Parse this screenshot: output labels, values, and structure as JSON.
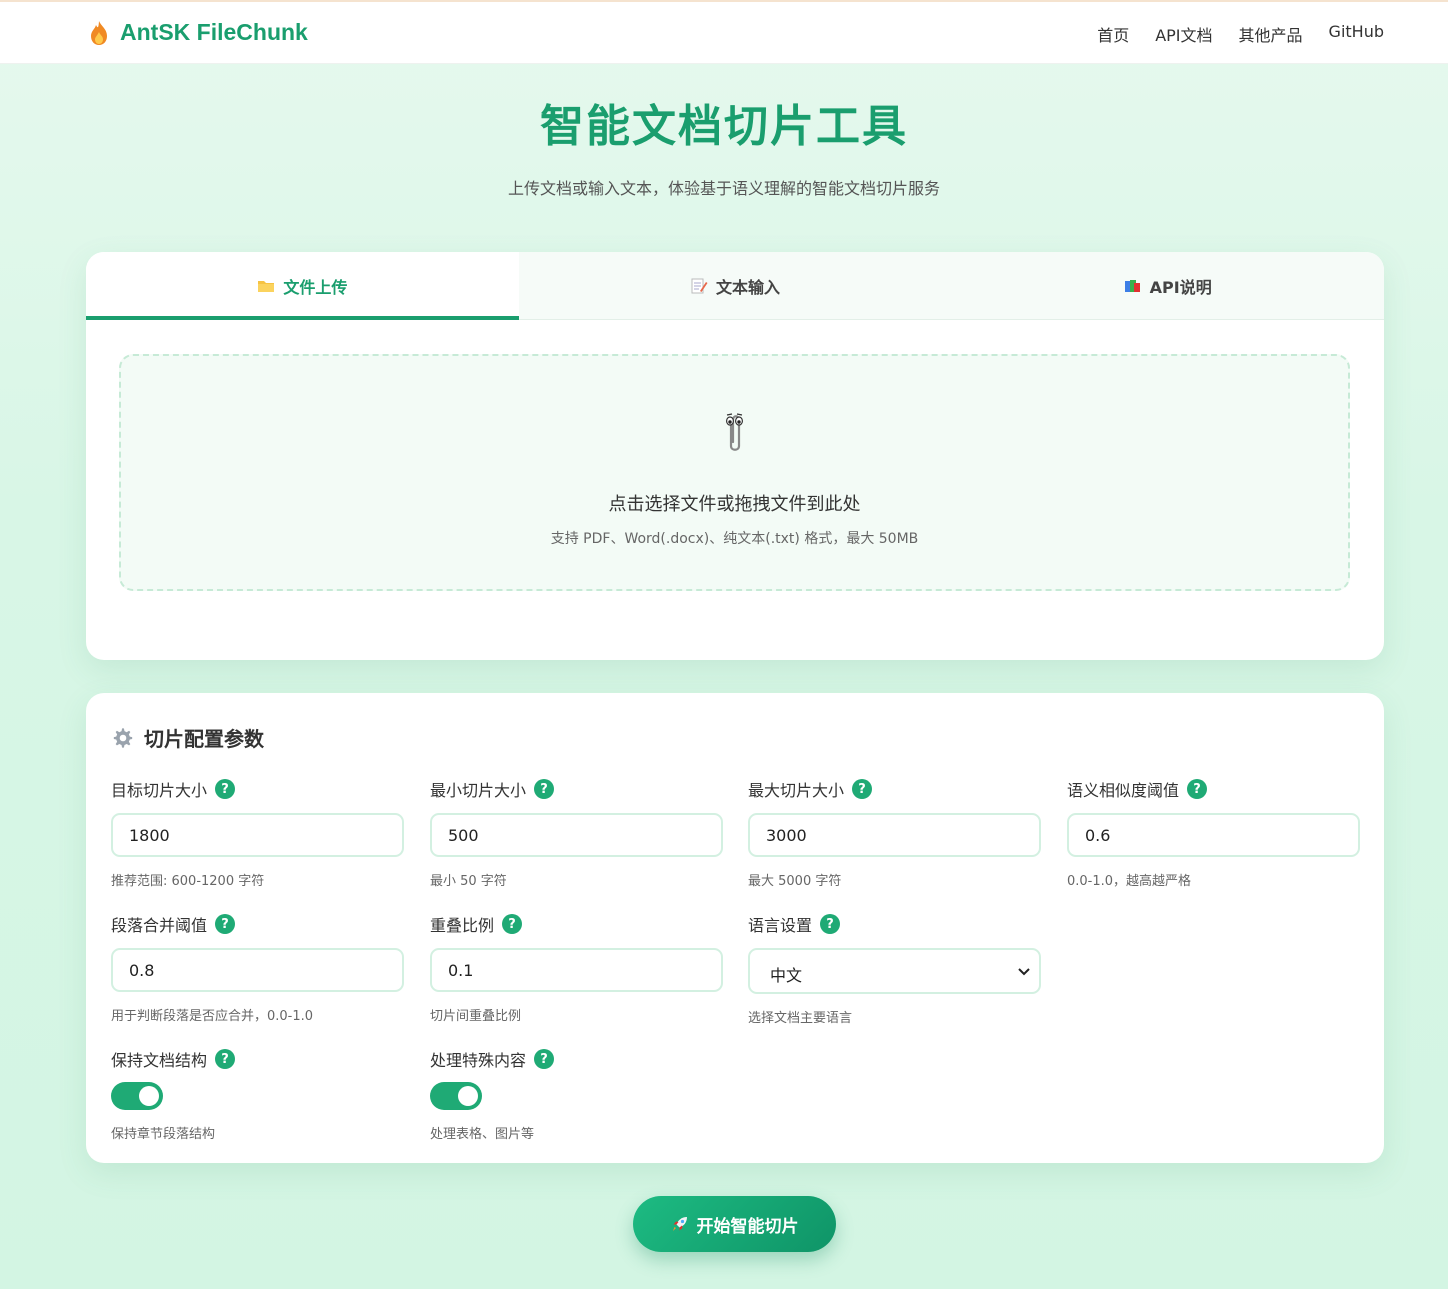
{
  "header": {
    "logo_text": "AntSK FileChunk",
    "nav": [
      "首页",
      "API文档",
      "其他产品",
      "GitHub"
    ]
  },
  "hero": {
    "title": "智能文档切片工具",
    "subtitle": "上传文档或输入文本，体验基于语义理解的智能文档切片服务"
  },
  "tabs": [
    {
      "label": "文件上传",
      "icon": "folder-icon",
      "active": true
    },
    {
      "label": "文本输入",
      "icon": "memo-icon",
      "active": false
    },
    {
      "label": "API说明",
      "icon": "books-icon",
      "active": false
    }
  ],
  "dropzone": {
    "icon": "paperclip-icon",
    "title": "点击选择文件或拖拽文件到此处",
    "subtitle": "支持 PDF、Word(.docx)、纯文本(.txt) 格式，最大 50MB"
  },
  "config": {
    "title": "切片配置参数",
    "fields": {
      "target_size": {
        "label": "目标切片大小",
        "value": "1800",
        "hint": "推荐范围: 600-1200 字符"
      },
      "min_size": {
        "label": "最小切片大小",
        "value": "500",
        "hint": "最小 50 字符"
      },
      "max_size": {
        "label": "最大切片大小",
        "value": "3000",
        "hint": "最大 5000 字符"
      },
      "similarity": {
        "label": "语义相似度阈值",
        "value": "0.6",
        "hint": "0.0-1.0，越高越严格"
      },
      "merge": {
        "label": "段落合并阈值",
        "value": "0.8",
        "hint": "用于判断段落是否应合并，0.0-1.0"
      },
      "overlap": {
        "label": "重叠比例",
        "value": "0.1",
        "hint": "切片间重叠比例"
      },
      "language": {
        "label": "语言设置",
        "value": "中文",
        "hint": "选择文档主要语言"
      },
      "keep_structure": {
        "label": "保持文档结构",
        "enabled": true,
        "hint": "保持章节段落结构"
      },
      "special_content": {
        "label": "处理特殊内容",
        "enabled": true,
        "hint": "处理表格、图片等"
      }
    },
    "help_glyph": "?"
  },
  "action": {
    "start_label": "开始智能切片"
  },
  "colors": {
    "accent": "#1a9e6e",
    "toggle_on": "#1faa75",
    "input_border": "#d3f0e1"
  }
}
